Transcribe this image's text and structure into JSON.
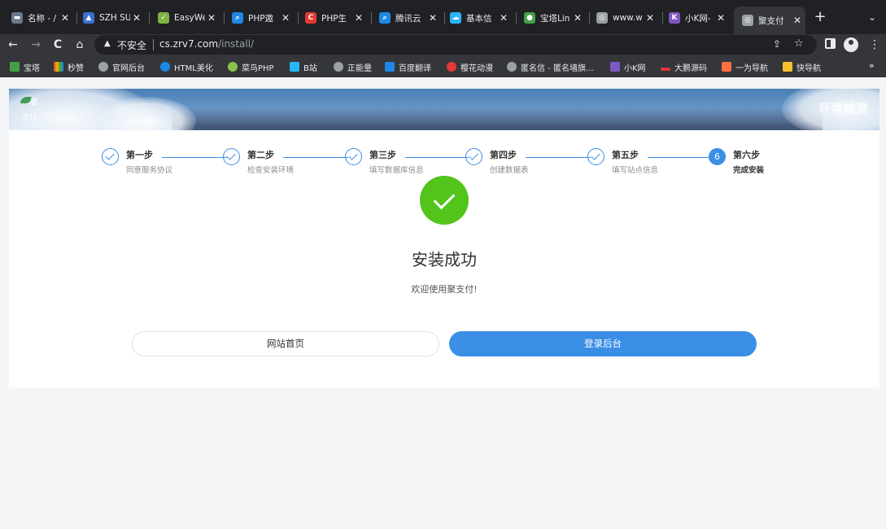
{
  "browser": {
    "tabs": [
      {
        "title": "名称 - /",
        "color": "#6b7a8c",
        "glyph": "▬"
      },
      {
        "title": "SZH SU",
        "color": "#3b6fd6",
        "glyph": "▲"
      },
      {
        "title": "EasyWe",
        "color": "#7cb342",
        "glyph": "✓"
      },
      {
        "title": "PHP邀",
        "color": "#1e88e5",
        "glyph": "⌕"
      },
      {
        "title": "PHP生",
        "color": "#e53935",
        "glyph": "C"
      },
      {
        "title": "腾讯云",
        "color": "#1e88e5",
        "glyph": "⌕"
      },
      {
        "title": "基本信",
        "color": "#29b6f6",
        "glyph": "☁"
      },
      {
        "title": "宝塔Lin",
        "color": "#43a047",
        "glyph": "●"
      },
      {
        "title": "www.w",
        "color": "#9aa0a6",
        "glyph": "◎"
      },
      {
        "title": "小K网-",
        "color": "#7e57c2",
        "glyph": "K"
      },
      {
        "title": "聚支付",
        "color": "#9aa0a6",
        "glyph": "◎"
      }
    ],
    "close_glyph": "✕",
    "newtab_glyph": "+",
    "tabsearch_glyph": "⌄",
    "nav": {
      "back": "←",
      "forward": "→",
      "reload": "C",
      "home": "⌂"
    },
    "address": {
      "warn_glyph": "▲",
      "insecure_label": "不安全",
      "host": "cs.zrv7.com",
      "path": "/install/"
    },
    "share_glyph": "⇪",
    "star_glyph": "☆",
    "menu_glyph": "⋮",
    "bookmarks": [
      {
        "label": "宝塔",
        "color": "#43a047"
      },
      {
        "label": "秒赞",
        "color": "#f4b400"
      },
      {
        "label": "官网后台",
        "color": "#9aa0a6"
      },
      {
        "label": "HTML美化",
        "color": "#1e88e5"
      },
      {
        "label": "菜鸟PHP",
        "color": "#8bc34a"
      },
      {
        "label": "B站",
        "color": "#29b6f6"
      },
      {
        "label": "正能量",
        "color": "#9aa0a6"
      },
      {
        "label": "百度翻译",
        "color": "#1e88e5"
      },
      {
        "label": "樱花动漫",
        "color": "#e53935"
      },
      {
        "label": "匿名信 - 匿名墙旗...",
        "color": "#9aa0a6"
      },
      {
        "label": "小K网",
        "color": "#7e57c2"
      },
      {
        "label": "大鹏源码",
        "color": "#e53935"
      },
      {
        "label": "一为导航",
        "color": "#ff7043"
      },
      {
        "label": "快导航",
        "color": "#fbc02d"
      }
    ],
    "bookmarks_more": "»"
  },
  "page": {
    "logo_line1": "聚",
    "logo_line2": "支付",
    "banner_right": "环境检测",
    "steps": [
      {
        "title": "第一步",
        "desc": "同意服务协议",
        "done": true
      },
      {
        "title": "第二步",
        "desc": "检查安装环境",
        "done": true
      },
      {
        "title": "第三步",
        "desc": "填写数据库信息",
        "done": true
      },
      {
        "title": "第四步",
        "desc": "创建数据表",
        "done": true
      },
      {
        "title": "第五步",
        "desc": "填写站点信息",
        "done": true
      },
      {
        "title": "第六步",
        "desc": "完成安装",
        "done": false,
        "number": "6"
      }
    ],
    "success_title": "安装成功",
    "success_message": "欢迎使用聚支付!",
    "home_button": "网站首页",
    "login_button": "登录后台",
    "accent_color": "#3a8ee6",
    "success_color": "#52c41a"
  }
}
